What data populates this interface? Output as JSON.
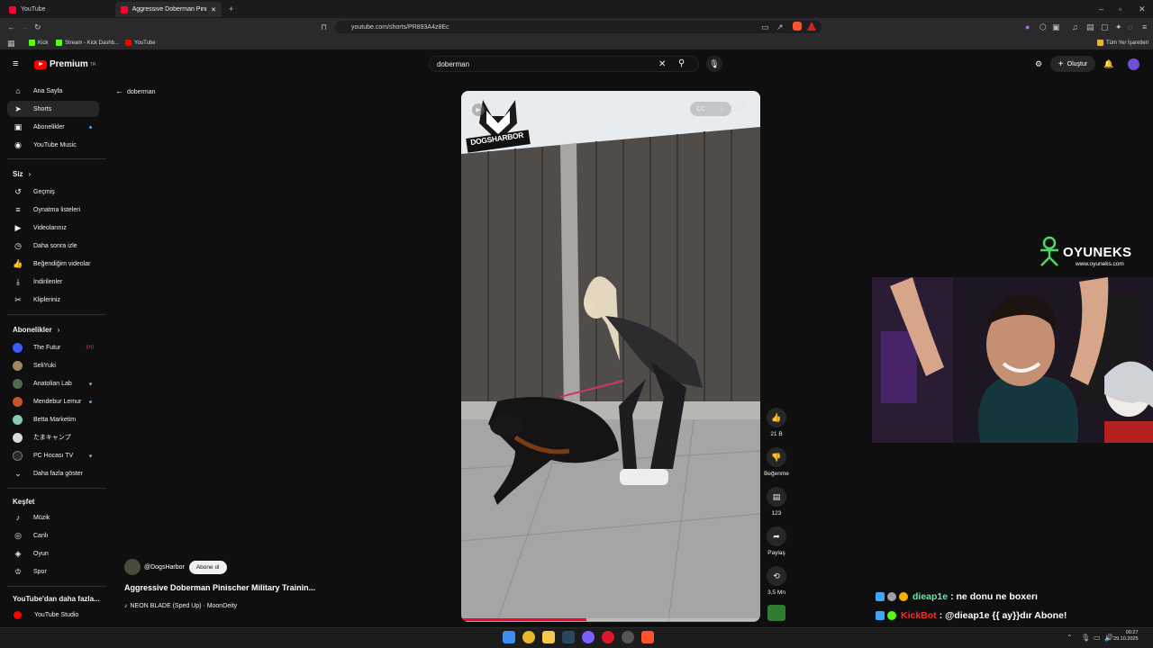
{
  "browser": {
    "tabs": [
      {
        "title": "YouTube"
      },
      {
        "title": "Aggressive Doberman Pinische"
      }
    ],
    "url": "youtube.com/shorts/PR893A4z8Ec",
    "bookmarks": [
      {
        "label": "Kick",
        "color": "#53fc18"
      },
      {
        "label": "Stream - Kick Dashb...",
        "color": "#53fc18"
      },
      {
        "label": "YouTube",
        "color": "#ff0000"
      }
    ],
    "other_bookmarks": "Tüm Yer İşaretleri"
  },
  "youtube": {
    "brand": "Premium",
    "brand_sup": "TR",
    "search_value": "doberman",
    "create_label": "Oluştur"
  },
  "sidebar": {
    "main": [
      {
        "label": "Ana Sayfa",
        "icon": "home-icon",
        "glyph": "⌂"
      },
      {
        "label": "Shorts",
        "icon": "shorts-icon",
        "glyph": "➤"
      },
      {
        "label": "Abonelikler",
        "icon": "subscriptions-icon",
        "glyph": "▣"
      },
      {
        "label": "YouTube Music",
        "icon": "music-icon",
        "glyph": "◉"
      }
    ],
    "you_header": "Siz",
    "you": [
      {
        "label": "Geçmiş",
        "icon": "history-icon",
        "glyph": "↺"
      },
      {
        "label": "Oynatma listeleri",
        "icon": "playlists-icon",
        "glyph": "≡"
      },
      {
        "label": "Videolarınız",
        "icon": "your-videos-icon",
        "glyph": "▶"
      },
      {
        "label": "Daha sonra izle",
        "icon": "watch-later-icon",
        "glyph": "◷"
      },
      {
        "label": "Beğendiğim videolar",
        "icon": "liked-icon",
        "glyph": "👍"
      },
      {
        "label": "İndirilenler",
        "icon": "downloads-icon",
        "glyph": "⤓"
      },
      {
        "label": "Klipleriniz",
        "icon": "clips-icon",
        "glyph": "✂"
      }
    ],
    "subs_header": "Abonelikler",
    "subs": [
      {
        "label": "The Futur",
        "color": "#3d5afe",
        "badge": "live"
      },
      {
        "label": "SeliYuki",
        "color": "#9e8a5a"
      },
      {
        "label": "Anatolian Lab",
        "color": "#4f6b4f"
      },
      {
        "label": "Mendebur Lemur",
        "color": "#c2572e"
      },
      {
        "label": "Betta Marketim",
        "color": "#86c9b5"
      },
      {
        "label": "たまキャンプ",
        "color": "#d9d9d9"
      },
      {
        "label": "PC Hocası TV",
        "color": "#2b2b2b"
      }
    ],
    "show_more": "Daha fazla göster",
    "explore_header": "Keşfet",
    "explore": [
      {
        "label": "Müzik",
        "icon": "music-note-icon",
        "glyph": "♪"
      },
      {
        "label": "Canlı",
        "icon": "live-icon",
        "glyph": "◎"
      },
      {
        "label": "Oyun",
        "icon": "gaming-icon",
        "glyph": "◈"
      },
      {
        "label": "Spor",
        "icon": "trophy-icon",
        "glyph": "♔"
      }
    ],
    "more_header": "YouTube'dan daha fazla...",
    "more": [
      {
        "label": "YouTube Studio",
        "color": "#ff0000"
      }
    ]
  },
  "shorts": {
    "back_label": "doberman",
    "watermark": "DOGSHARBOR",
    "like_count": "21 B",
    "dislike_label": "Beğenme",
    "comment_count": "123",
    "share_label": "Paylaş",
    "remix_count": "3,5 Mn",
    "channel": "@DogsHarbor",
    "subscribe_label": "Abone ol",
    "title": "Aggressive Doberman Pinischer Military Trainin...",
    "music": "NEON BLADE (Sped Up) · MoonDeity",
    "progress": 0.42
  },
  "overlay": {
    "brand": "OYUNEKS",
    "brand_url": "www.oyuneks.com",
    "chat": [
      {
        "user": "dieap1e",
        "user_color": "#59f0a6",
        "message": ": ne donu ne boxerı"
      },
      {
        "user": "KickBot",
        "user_color": "#ff2a2a",
        "message": ": @dieap1e {{ ay}}dır Abone!"
      }
    ]
  },
  "taskbar": {
    "time": "00:27",
    "date": "29.10.2025"
  }
}
